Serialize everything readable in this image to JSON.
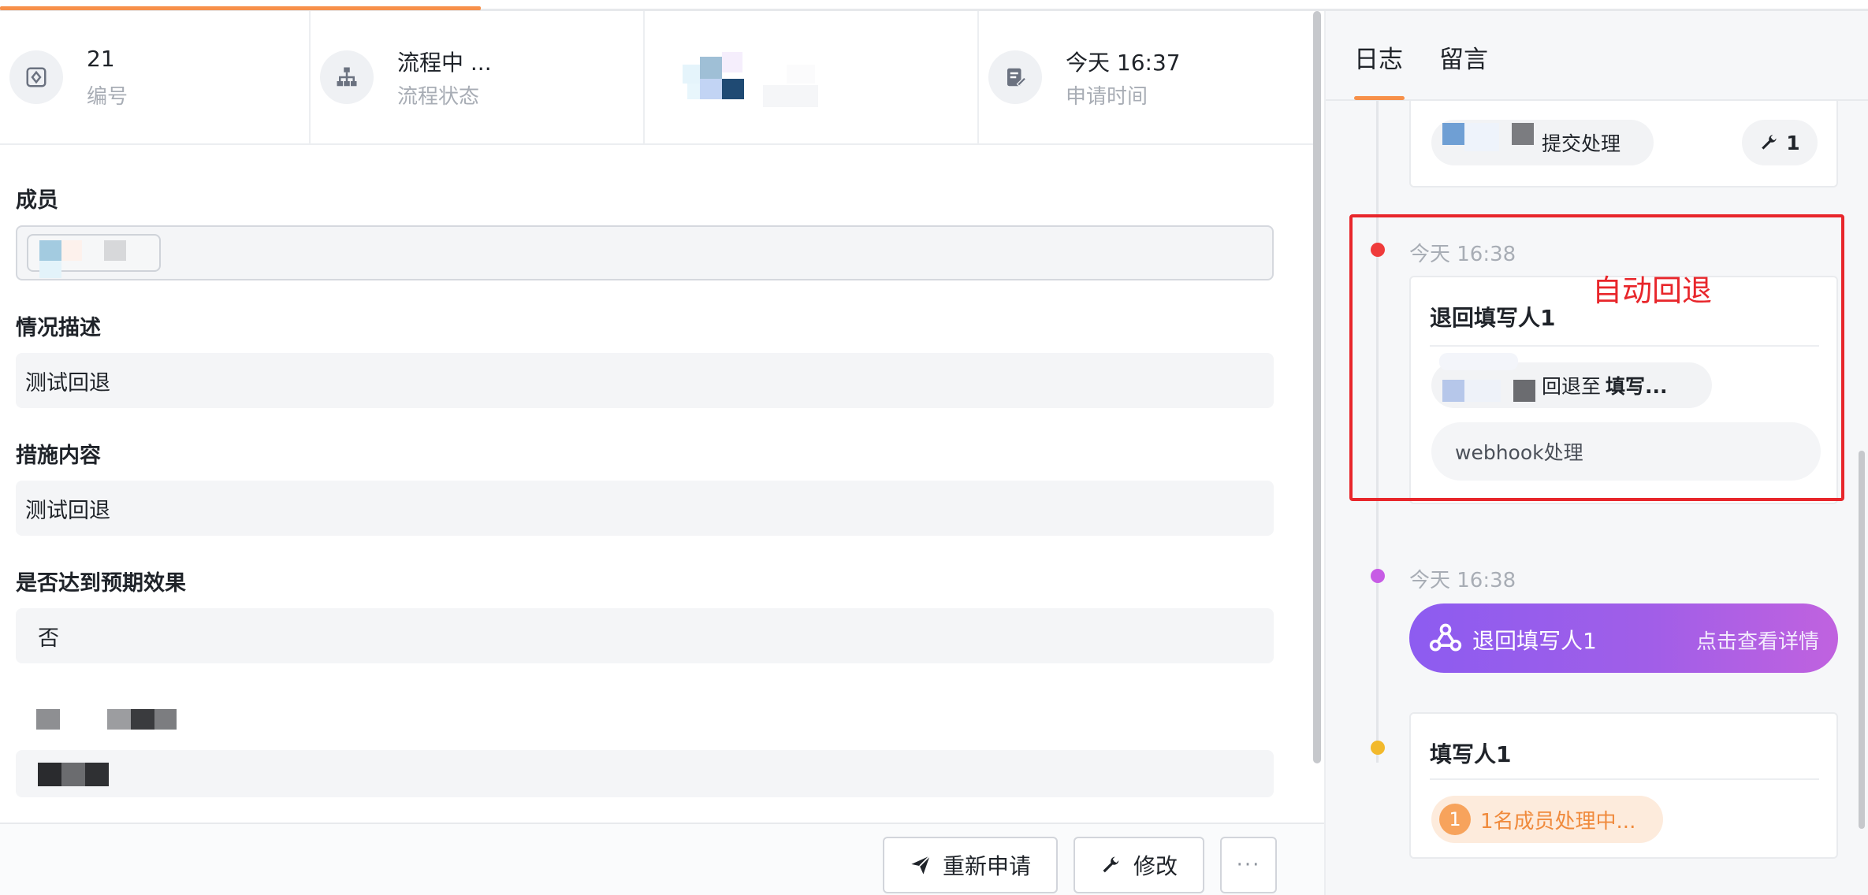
{
  "info_bar": {
    "id": {
      "value": "21",
      "label": "编号",
      "icon": "tag-icon"
    },
    "status": {
      "value": "流程中 ...",
      "label": "流程状态",
      "icon": "flowchart-icon"
    },
    "applicant": {
      "redacted": true
    },
    "time": {
      "value": "今天 16:37",
      "label": "申请时间",
      "icon": "document-edit-icon"
    }
  },
  "form": {
    "members": {
      "label": "成员"
    },
    "description": {
      "label": "情况描述",
      "value": "测试回退"
    },
    "measures": {
      "label": "措施内容",
      "value": "测试回退"
    },
    "expected": {
      "label": "是否达到预期效果",
      "value": "否"
    }
  },
  "actions": {
    "reapply": "重新申请",
    "modify": "修改",
    "more": "···"
  },
  "right_panel": {
    "tabs": [
      {
        "label": "日志"
      },
      {
        "label": "留言"
      }
    ],
    "log": {
      "top_card": {
        "action": "提交处理",
        "count": "1"
      },
      "rollback": {
        "time": "今天 16:38",
        "title": "退回填写人1",
        "action_prefix": "回退至",
        "action_target": "填写...",
        "note": "webhook处理",
        "annotation": "自动回退"
      },
      "webhook": {
        "time": "今天 16:38",
        "title": "退回填写人1",
        "link": "点击查看详情"
      },
      "filler": {
        "title": "填写人1",
        "status_count": "1",
        "status_text": "1名成员处理中..."
      }
    }
  },
  "colors": {
    "accent": "#f7904a",
    "danger": "#e8262b",
    "webhook_gradient_start": "#8d5cf0",
    "webhook_gradient_end": "#c062df"
  }
}
